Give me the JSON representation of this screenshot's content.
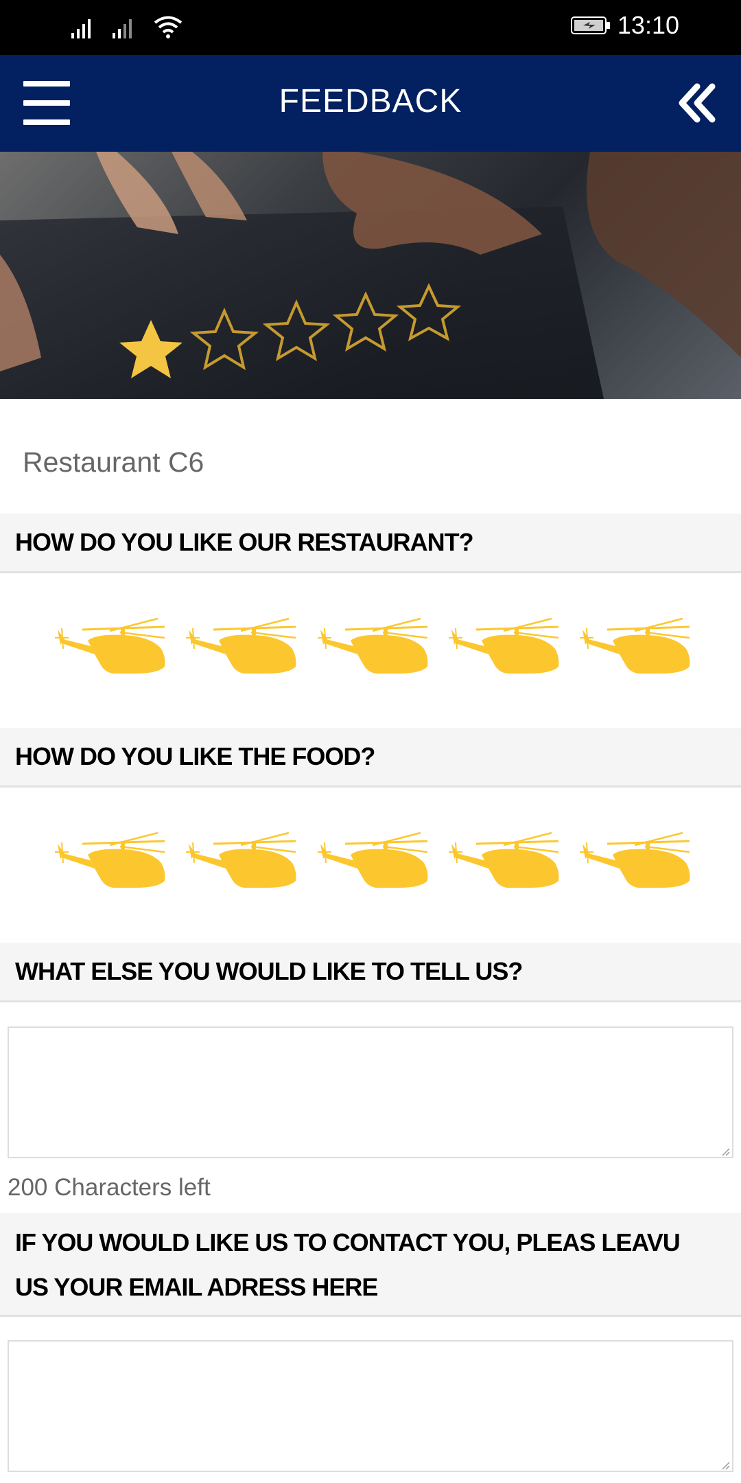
{
  "status_bar": {
    "time": "13:10",
    "icons": [
      "signal-icon",
      "signal-icon",
      "wifi-icon",
      "battery-charging-icon"
    ]
  },
  "app_bar": {
    "title": "FEEDBACK",
    "menu_icon": "hamburger-menu-icon",
    "back_icon": "double-chevron-left-icon"
  },
  "banner": {
    "image": "hands-holding-phone-with-star-rating",
    "stars_filled": 1,
    "stars_total": 5
  },
  "restaurant": {
    "name": "Restaurant C6"
  },
  "questions": [
    {
      "label": "HOW DO YOU LIKE OUR RESTAURANT?",
      "rating_icon": "helicopter-icon",
      "rating_max": 5
    },
    {
      "label": "HOW DO YOU LIKE THE FOOD?",
      "rating_icon": "helicopter-icon",
      "rating_max": 5
    },
    {
      "label": "WHAT ELSE YOU WOULD LIKE TO TELL US?"
    },
    {
      "label": "IF YOU WOULD LIKE US TO CONTACT YOU, PLEAS LEAVU US YOUR EMAIL ADRESS HERE"
    }
  ],
  "comment": {
    "value": "",
    "chars_left": "200 Characters left"
  },
  "email": {
    "value": ""
  },
  "colors": {
    "app_bar": "#032060",
    "status_bar": "#000000",
    "rating_icon": "#FCC72E",
    "section_header_bg": "#F5F5F5",
    "muted_text": "#666666"
  }
}
